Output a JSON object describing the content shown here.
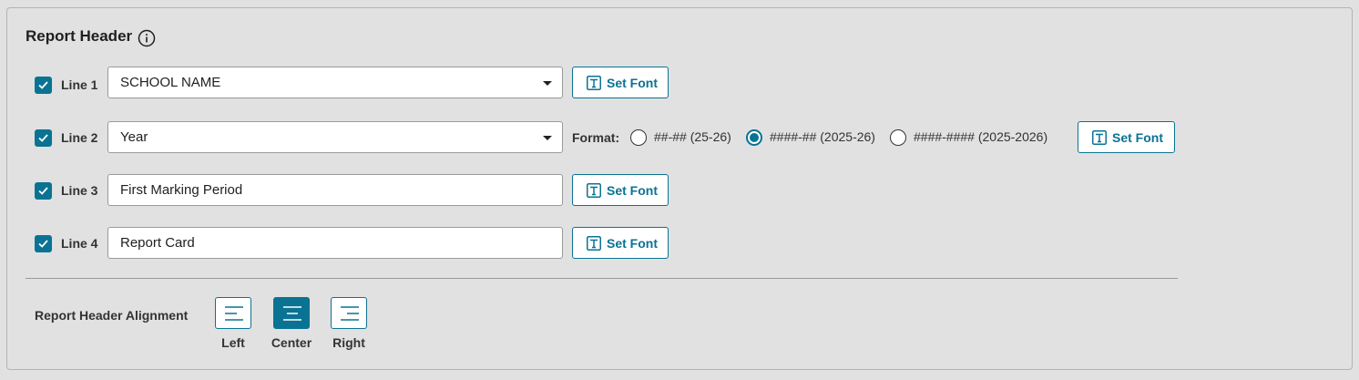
{
  "section": {
    "title": "Report Header"
  },
  "lines": [
    {
      "label": "Line 1",
      "value": "SCHOOL NAME",
      "checked": true,
      "type": "dropdown"
    },
    {
      "label": "Line 2",
      "value": "Year",
      "checked": true,
      "type": "dropdown"
    },
    {
      "label": "Line 3",
      "value": "First Marking Period",
      "checked": true,
      "type": "text"
    },
    {
      "label": "Line 4",
      "value": "Report Card",
      "checked": true,
      "type": "text"
    }
  ],
  "set_font_label": "Set Font",
  "format": {
    "label": "Format:",
    "options": [
      {
        "label": "##-## (25-26)",
        "selected": false
      },
      {
        "label": "####-## (2025-26)",
        "selected": true
      },
      {
        "label": "####-#### (2025-2026)",
        "selected": false
      }
    ]
  },
  "alignment": {
    "label": "Report Header Alignment",
    "options": [
      {
        "label": "Left",
        "active": false
      },
      {
        "label": "Center",
        "active": true
      },
      {
        "label": "Right",
        "active": false
      }
    ]
  },
  "colors": {
    "accent": "#0a7393",
    "background": "#e1e1e1"
  }
}
